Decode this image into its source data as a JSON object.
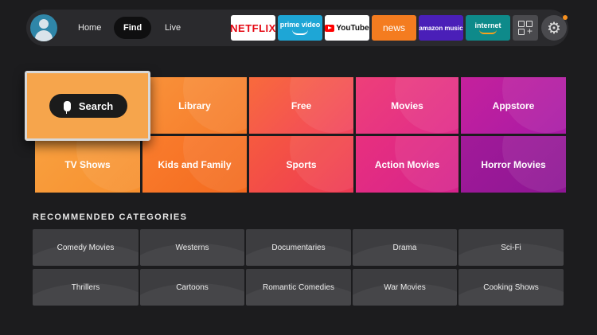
{
  "nav": {
    "home": "Home",
    "find": "Find",
    "live": "Live"
  },
  "apps": {
    "netflix": "NETFLIX",
    "prime_video": "prime video",
    "youtube": "YouTube",
    "news": "news",
    "amazon_music": "amazon music",
    "internet": "internet"
  },
  "icons": {
    "profile": "avatar-icon",
    "apps": "apps-grid-icon",
    "settings": "gear-icon",
    "mic": "microphone-icon"
  },
  "grid": {
    "search": "Search",
    "library": "Library",
    "free": "Free",
    "movies": "Movies",
    "appstore": "Appstore",
    "tv_shows": "TV Shows",
    "kids_family": "Kids and Family",
    "sports": "Sports",
    "action_movies": "Action Movies",
    "horror_movies": "Horror Movies"
  },
  "recommended": {
    "title": "RECOMMENDED CATEGORIES",
    "row1": [
      "Comedy Movies",
      "Westerns",
      "Documentaries",
      "Drama",
      "Sci-Fi"
    ],
    "row2": [
      "Thrillers",
      "Cartoons",
      "Romantic Comedies",
      "War Movies",
      "Cooking Shows"
    ]
  },
  "colors": {
    "accent_orange": "#f7901e",
    "background": "#1c1c1e"
  }
}
